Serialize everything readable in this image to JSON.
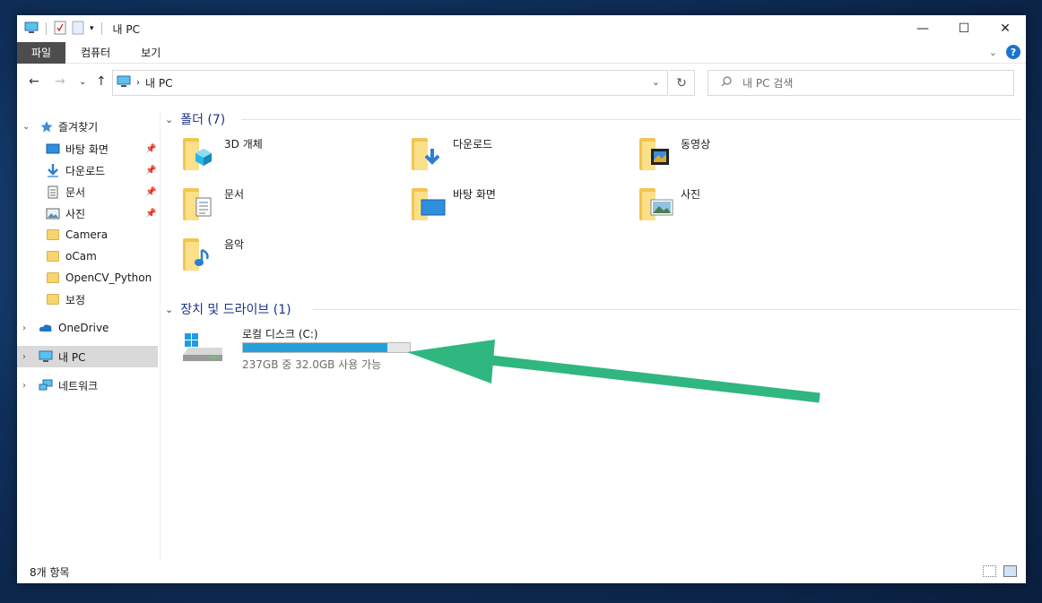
{
  "window": {
    "title": "내 PC"
  },
  "ribbon": {
    "tabs": [
      "파일",
      "컴퓨터",
      "보기"
    ]
  },
  "address": {
    "path": "내 PC"
  },
  "search": {
    "placeholder": "내 PC 검색"
  },
  "sidebar": {
    "quick_access": "즐겨찾기",
    "items": [
      {
        "label": "바탕 화면"
      },
      {
        "label": "다운로드"
      },
      {
        "label": "문서"
      },
      {
        "label": "사진"
      },
      {
        "label": "Camera"
      },
      {
        "label": "oCam"
      },
      {
        "label": "OpenCV_Python"
      },
      {
        "label": "보정"
      }
    ],
    "onedrive": "OneDrive",
    "thispc": "내 PC",
    "network": "네트워크"
  },
  "main": {
    "folders_header": "폴더 (7)",
    "folders": [
      "3D 개체",
      "다운로드",
      "동영상",
      "문서",
      "바탕 화면",
      "사진",
      "음악"
    ],
    "devices_header": "장치 및 드라이브 (1)",
    "drive": {
      "name": "로컬 디스크 (C:)",
      "info": "237GB 중 32.0GB 사용 가능",
      "used_fraction": 0.865
    }
  },
  "status": {
    "count": "8개 항목"
  },
  "colors": {
    "accent": "#26a0da",
    "arrow": "#2fb77f",
    "header": "#1e3287"
  }
}
